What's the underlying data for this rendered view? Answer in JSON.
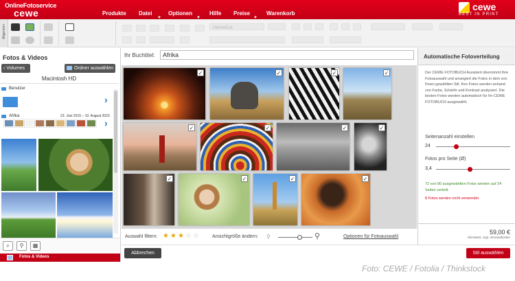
{
  "header": {
    "logo_line1": "OnlineFotoservice",
    "logo_line2": "cewe",
    "nav": [
      "Produkte",
      "Datei",
      "Optionen",
      "Hilfe",
      "Preise",
      "Warenkorb"
    ],
    "brand_name": "cewe",
    "brand_tagline": "BEST IN PRINT"
  },
  "toolbar": {
    "side_label": "Allgemein",
    "font_name": "Helvetica"
  },
  "left_panel": {
    "title": "Fotos & Videos",
    "volumes_button": "Volumes",
    "choose_folder_button": "Ordner auswählen",
    "drive_title": "Macintosh HD",
    "folders": [
      {
        "name": "Benutzer",
        "date": ""
      },
      {
        "name": "Afrika",
        "date": "23. Juni 2015 – 10. August 2015"
      }
    ],
    "tab_label": "Fotos & Videos"
  },
  "center": {
    "title_label": "Ihr Buchtitel:",
    "title_value": "Afrika",
    "checkmark": "✓",
    "filter_label": "Auswahl filtern:",
    "rating": 3,
    "rating_max": 5,
    "view_label": "Ansichtgröße ändern:",
    "options_link": "Optionen für Fotoauswahl"
  },
  "right_panel": {
    "title": "Automatische Fotoverteilung",
    "description": "Der CEWE FOTOBUCH Assistent übernimmt Ihre Fotoauswahl und arrangiert die Fotos in dem von Ihnen gewählten Stil. Ihre Fotos werden anhand von Farbe, Schärfe und Kontrast analysiert. Die besten Fotos werden automatisch für Ihr CEWE FOTOBUCH ausgewählt.",
    "pages_label": "Seitenanzahl einstellen",
    "pages_value": "24",
    "per_page_label": "Fotos pro Seite (Ø)",
    "per_page_value": "3,4",
    "green_info": "72 von 80 ausgewählten Fotos werden auf 24 Seiten verteilt.",
    "red_info": "8 Fotos werden nicht verwendet.",
    "price": "59,00 €",
    "price_note": "inkl.MwSt. zzgl. Versandkosten"
  },
  "buttons": {
    "cancel": "Abbrechen",
    "select": "Stil auswählen"
  },
  "caption": "Foto: CEWE / Fotolia / Thinkstock",
  "colors": {
    "brand_red": "#c20016",
    "folder_blue": "#3e8edc",
    "info_green": "#3a8a2a",
    "info_red": "#d0021b",
    "star_gold": "#e6a800"
  }
}
